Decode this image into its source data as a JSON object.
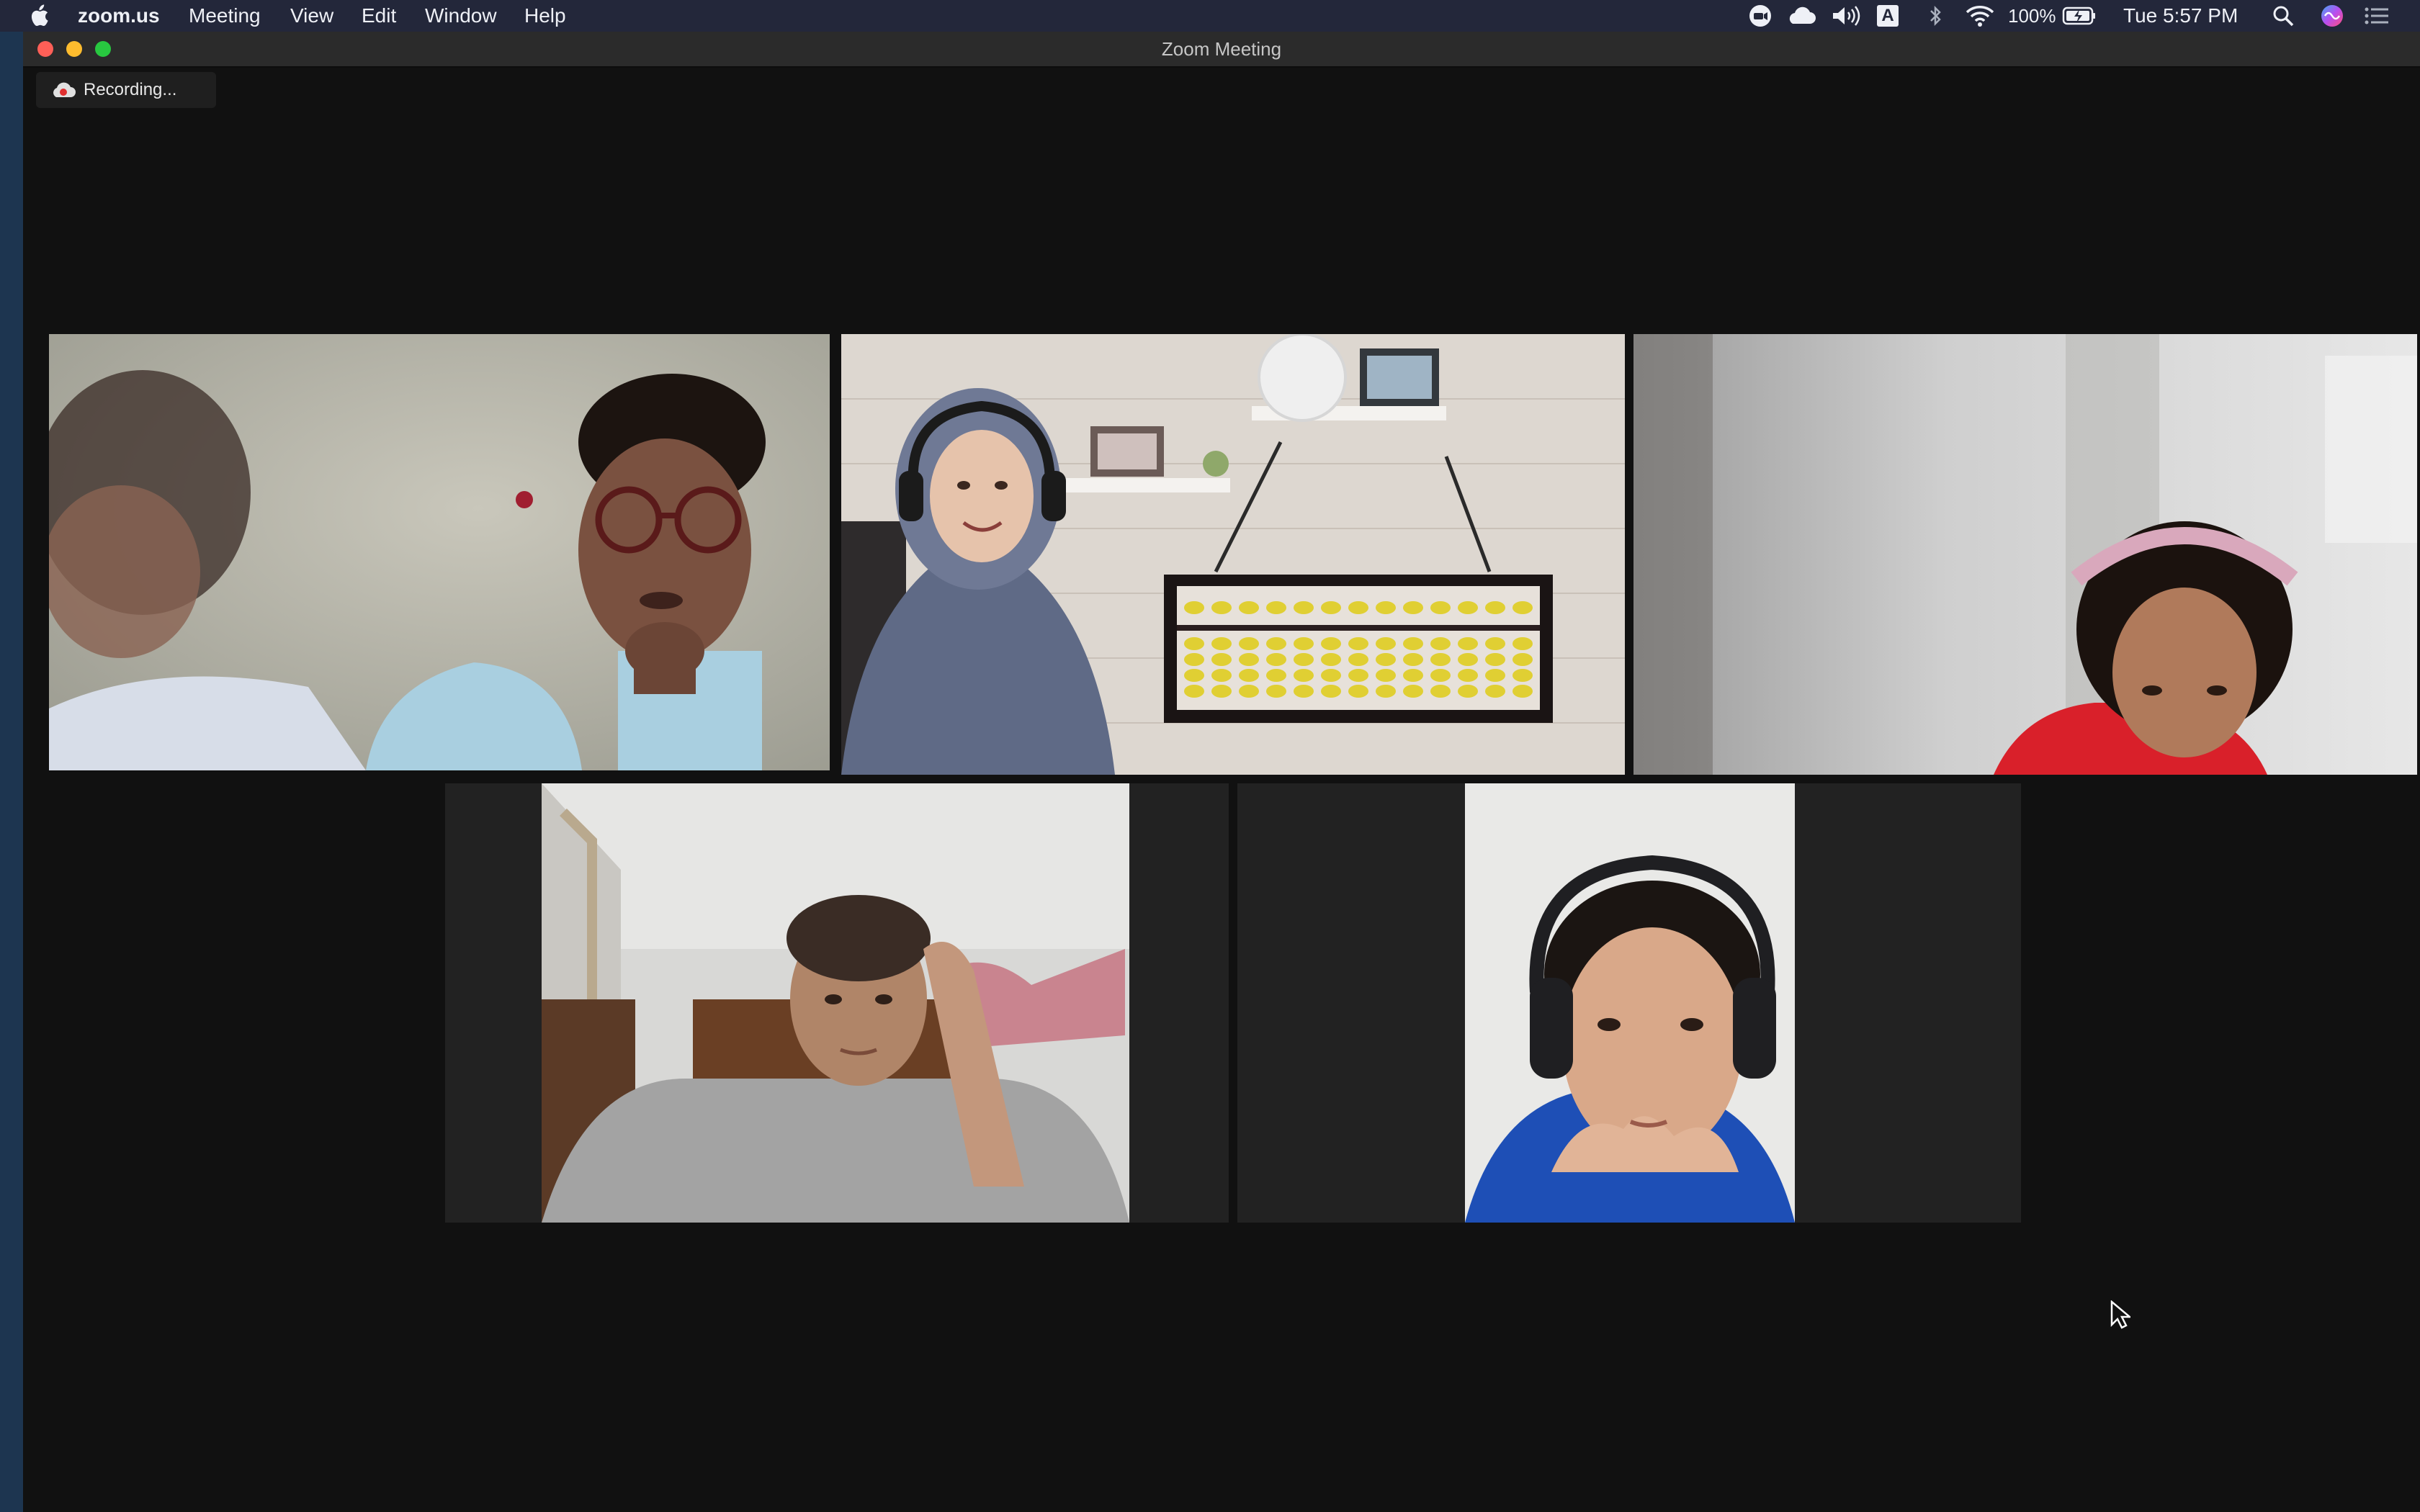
{
  "menubar": {
    "apple_icon": "apple-icon",
    "app_name": "zoom.us",
    "menus": [
      "Meeting",
      "View",
      "Edit",
      "Window",
      "Help"
    ],
    "status": {
      "battery_percent": "100%",
      "clock": "Tue 5:57 PM",
      "input_source": "A"
    }
  },
  "window": {
    "title": "Zoom Meeting",
    "recording_label": "Recording...",
    "active_border_color": "#25d366"
  },
  "participants": [
    {
      "id": "p1",
      "active_speaker": true
    },
    {
      "id": "p2",
      "active_speaker": false
    },
    {
      "id": "p3",
      "active_speaker": false
    },
    {
      "id": "p4",
      "active_speaker": false
    },
    {
      "id": "p5",
      "active_speaker": false
    }
  ]
}
